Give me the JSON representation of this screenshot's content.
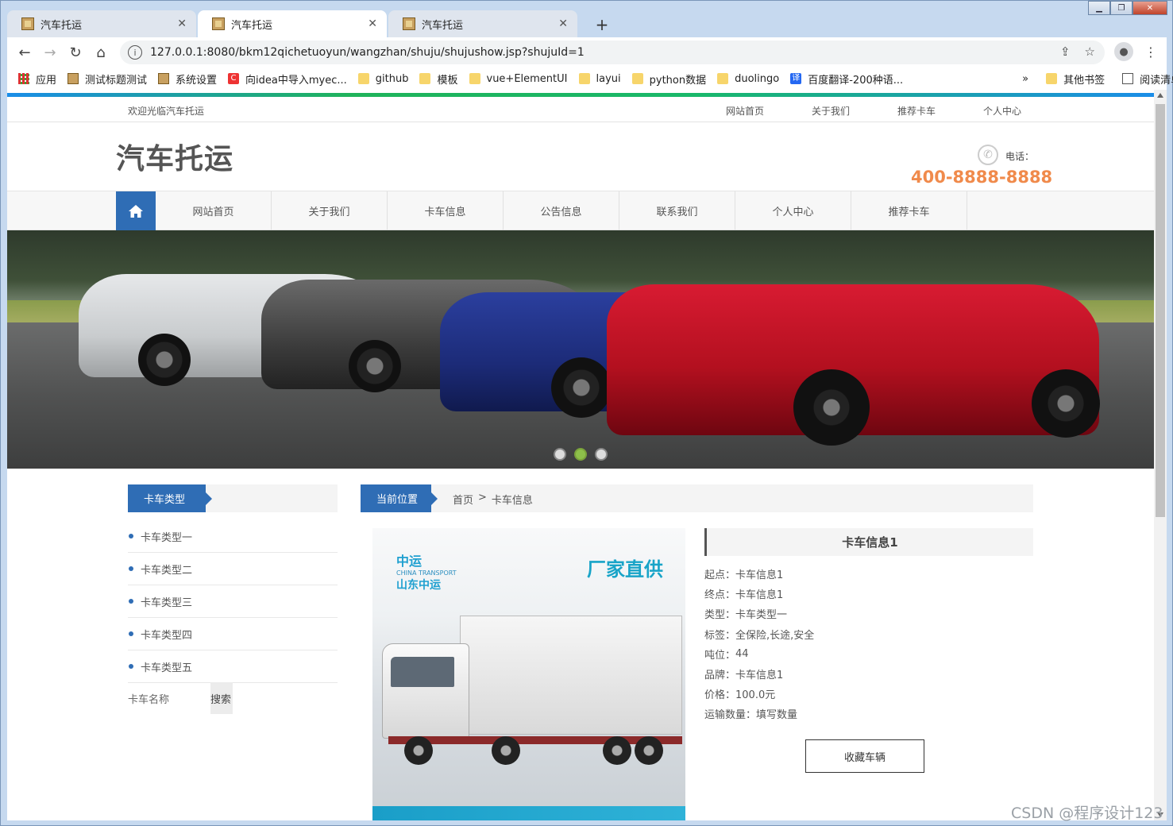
{
  "browser": {
    "tabs": [
      {
        "title": "汽车托运",
        "active": false
      },
      {
        "title": "汽车托运",
        "active": true
      },
      {
        "title": "汽车托运",
        "active": false
      }
    ],
    "url": "127.0.0.1:8080/bkm12qichetuoyun/wangzhan/shuju/shujushow.jsp?shujuId=1",
    "bookmarks": [
      {
        "label": "应用",
        "icon": "apps-grid-icon"
      },
      {
        "label": "测试标题测试",
        "icon": "page-icon"
      },
      {
        "label": "系统设置",
        "icon": "page-icon"
      },
      {
        "label": "向idea中导入myec...",
        "icon": "csdn-icon"
      },
      {
        "label": "github",
        "icon": "folder-icon"
      },
      {
        "label": "模板",
        "icon": "folder-icon"
      },
      {
        "label": "vue+ElementUI",
        "icon": "folder-icon"
      },
      {
        "label": "layui",
        "icon": "folder-icon"
      },
      {
        "label": "python数据",
        "icon": "folder-icon"
      },
      {
        "label": "duolingo",
        "icon": "folder-icon"
      },
      {
        "label": "百度翻译-200种语...",
        "icon": "translate-icon"
      }
    ],
    "more": "»",
    "other_bookmarks": "其他书签",
    "reading_list": "阅读清单"
  },
  "site": {
    "welcome": "欢迎光临汽车托运",
    "top_links": [
      "网站首页",
      "关于我们",
      "推荐卡车",
      "个人中心"
    ],
    "brand": "汽车托运",
    "phone_label": "电话：",
    "phone_number": "400-8888-8888",
    "nav": [
      "网站首页",
      "关于我们",
      "卡车信息",
      "公告信息",
      "联系我们",
      "个人中心",
      "推荐卡车"
    ],
    "carousel": {
      "count": 3,
      "active_index": 1
    }
  },
  "sidebar": {
    "heading": "卡车类型",
    "categories": [
      "卡车类型一",
      "卡车类型二",
      "卡车类型三",
      "卡车类型四",
      "卡车类型五"
    ],
    "search_label": "卡车名称",
    "search_button": "搜索"
  },
  "breadcrumb": {
    "heading": "当前位置",
    "home": "首页",
    "sep": ">",
    "current": "卡车信息"
  },
  "product_image": {
    "brand_cn": "中运",
    "brand_en": "CHINA TRANSPORT",
    "brand_sub": "山东中运",
    "slogan": "厂家直供"
  },
  "detail": {
    "title": "卡车信息1",
    "rows": [
      {
        "label": "起点：",
        "value": "卡车信息1"
      },
      {
        "label": "终点：",
        "value": "卡车信息1"
      },
      {
        "label": "类型：",
        "value": "卡车类型一"
      },
      {
        "label": "标签：",
        "value": "全保险,长途,安全"
      },
      {
        "label": "吨位：",
        "value": "44"
      },
      {
        "label": "品牌：",
        "value": "卡车信息1"
      },
      {
        "label": "价格：",
        "value": "100.0元"
      },
      {
        "label": "运输数量：",
        "value": "填写数量"
      }
    ],
    "favorite_button": "收藏车辆"
  },
  "watermark": "CSDN @程序设计123",
  "colors": {
    "primary": "#2f6db5",
    "phone": "#f08a4b",
    "carousel_active": "#8dc04a"
  }
}
